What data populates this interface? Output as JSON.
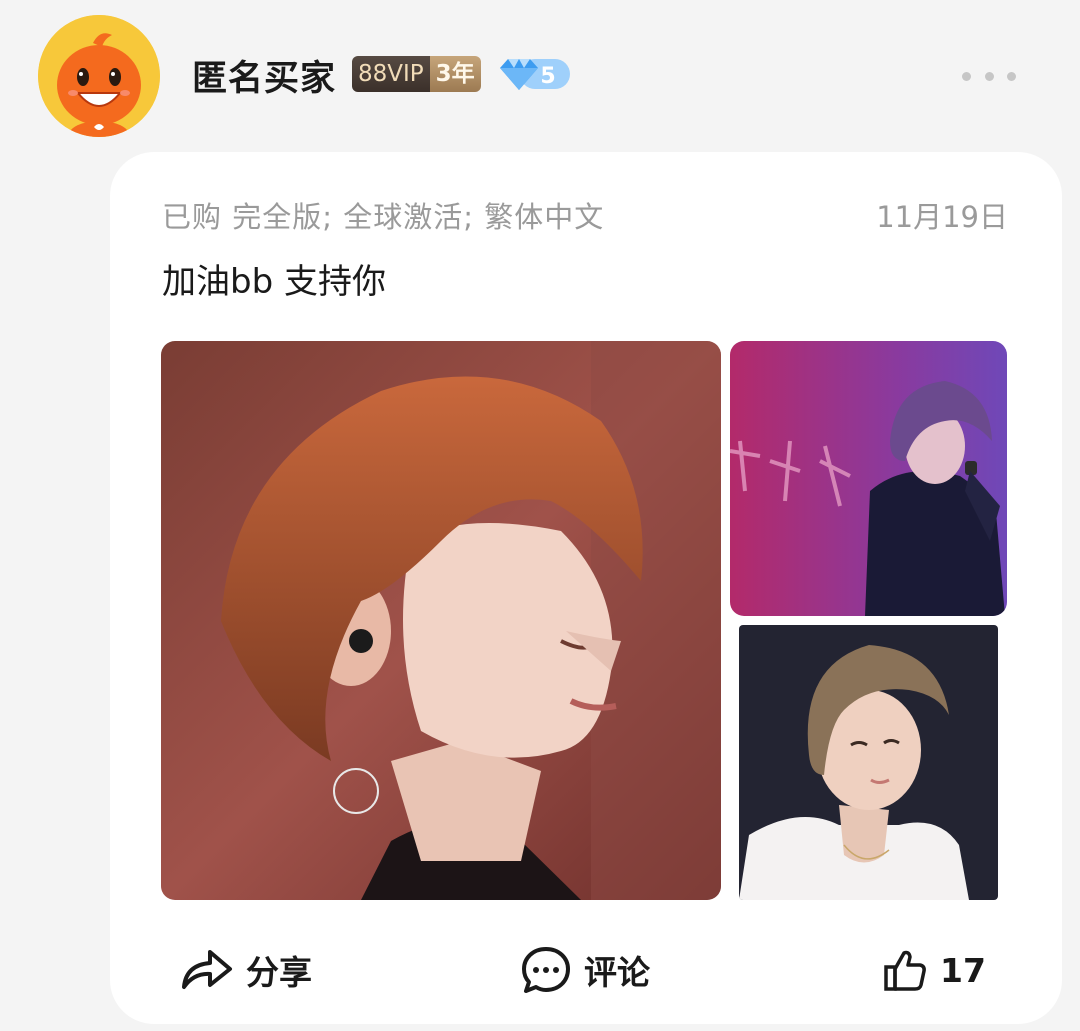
{
  "header": {
    "avatar_icon": "orange-mascot-avatar",
    "username": "匿名买家",
    "vip_label": "88VIP",
    "vip_years": "3年",
    "level_icon": "diamond-icon",
    "level": "5",
    "more_icon": "more-dots-icon"
  },
  "review": {
    "purchase_info": "已购 完全版; 全球激活; 繁体中文",
    "date": "11月19日",
    "text": "加油bb 支持你",
    "photos": [
      {
        "name": "review-photo-1",
        "icon": "photo"
      },
      {
        "name": "review-photo-2",
        "icon": "photo"
      },
      {
        "name": "review-photo-3",
        "icon": "photo"
      }
    ]
  },
  "actions": {
    "share_label": "分享",
    "comment_label": "评论",
    "like_count": "17"
  },
  "colors": {
    "page_bg": "#f4f4f4",
    "card_bg": "#ffffff",
    "meta_text": "#9a9a9a",
    "primary_text": "#1a1a1a",
    "avatar_bg": "#f7c83a",
    "diamond": "#4aa8f5"
  }
}
